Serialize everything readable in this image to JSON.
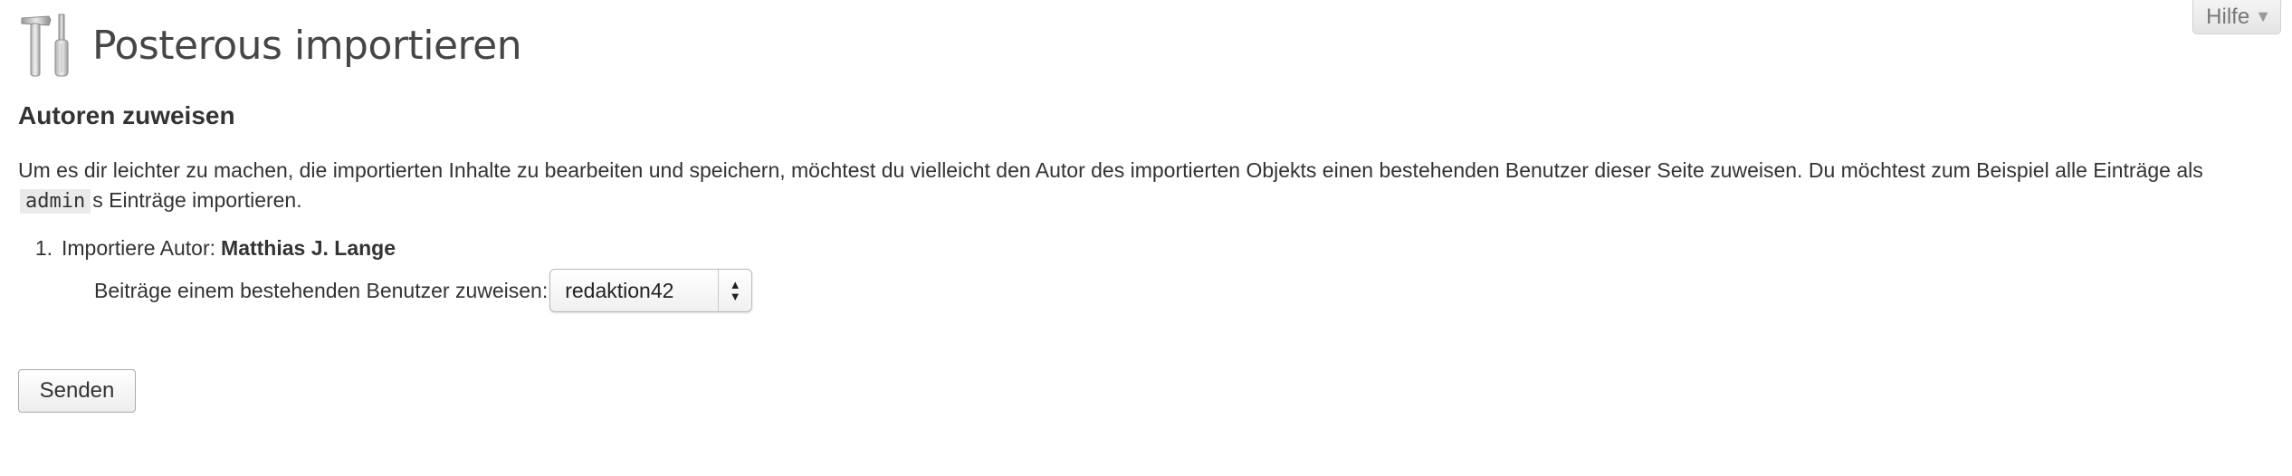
{
  "help_tab": {
    "label": "Hilfe",
    "arrow": "▼"
  },
  "header": {
    "icon": "tools-icon",
    "title": "Posterous importieren"
  },
  "section": {
    "title": "Autoren zuweisen"
  },
  "intro": {
    "text_before": "Um es dir leichter zu machen, die importierten Inhalte zu bearbeiten und speichern, möchtest du vielleicht den Autor des importierten Objekts einen bestehenden Benutzer dieser Seite zuweisen. Du möchtest zum Beispiel alle Einträge als",
    "code": "admin",
    "text_after": "s Einträge importieren."
  },
  "authors": [
    {
      "number": "1.",
      "label": "Importiere Autor:",
      "name": "Matthias J. Lange",
      "assign_label": "Beiträge einem bestehenden Benutzer zuweisen:",
      "selected_user": "redaktion42"
    }
  ],
  "submit": {
    "label": "Senden"
  }
}
